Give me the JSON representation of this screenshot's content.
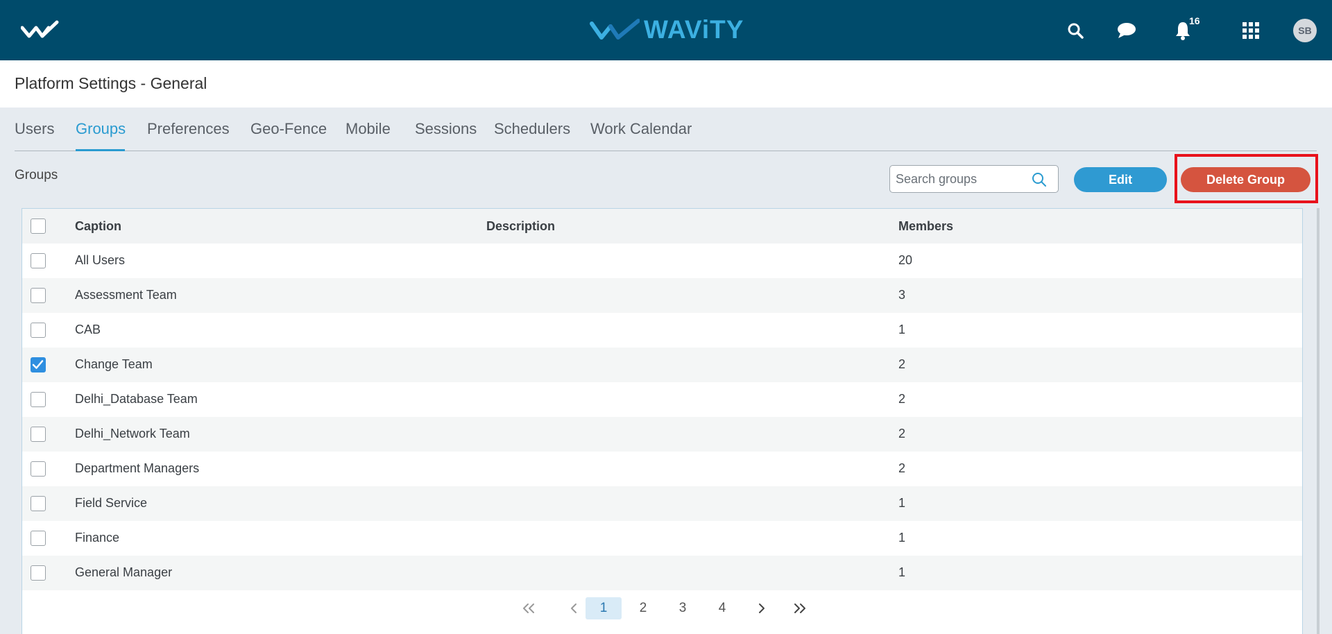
{
  "topbar": {
    "brand": "WAViTY",
    "notification_count": "16",
    "avatar_initials": "SB",
    "colors": {
      "background": "#004b6b",
      "brand": "#3cb0e2"
    },
    "icons": [
      "home-logo-icon",
      "search-icon",
      "chat-icon",
      "bell-icon",
      "apps-grid-icon"
    ]
  },
  "page": {
    "title": "Platform Settings - General"
  },
  "tabs": [
    {
      "label": "Users",
      "active": false
    },
    {
      "label": "Groups",
      "active": true
    },
    {
      "label": "Preferences",
      "active": false
    },
    {
      "label": "Geo-Fence",
      "active": false
    },
    {
      "label": "Mobile",
      "active": false
    },
    {
      "label": "Sessions",
      "active": false
    },
    {
      "label": "Schedulers",
      "active": false
    },
    {
      "label": "Work Calendar",
      "active": false
    }
  ],
  "toolbar": {
    "section_label": "Groups",
    "search_placeholder": "Search groups",
    "edit_label": "Edit",
    "delete_label": "Delete Group",
    "colors": {
      "edit": "#2f9ad2",
      "delete": "#d5543f",
      "highlight": "#e8121c"
    }
  },
  "table": {
    "headers": {
      "caption": "Caption",
      "description": "Description",
      "members": "Members"
    },
    "rows": [
      {
        "caption": "All Users",
        "description": "",
        "members": "20",
        "checked": false
      },
      {
        "caption": "Assessment Team",
        "description": "",
        "members": "3",
        "checked": false
      },
      {
        "caption": "CAB",
        "description": "",
        "members": "1",
        "checked": false
      },
      {
        "caption": "Change Team",
        "description": "",
        "members": "2",
        "checked": true
      },
      {
        "caption": "Delhi_Database Team",
        "description": "",
        "members": "2",
        "checked": false
      },
      {
        "caption": "Delhi_Network Team",
        "description": "",
        "members": "2",
        "checked": false
      },
      {
        "caption": "Department Managers",
        "description": "",
        "members": "2",
        "checked": false
      },
      {
        "caption": "Field Service",
        "description": "",
        "members": "1",
        "checked": false
      },
      {
        "caption": "Finance",
        "description": "",
        "members": "1",
        "checked": false
      },
      {
        "caption": "General Manager",
        "description": "",
        "members": "1",
        "checked": false
      }
    ]
  },
  "pagination": {
    "pages": [
      "1",
      "2",
      "3",
      "4"
    ],
    "current": "1"
  }
}
